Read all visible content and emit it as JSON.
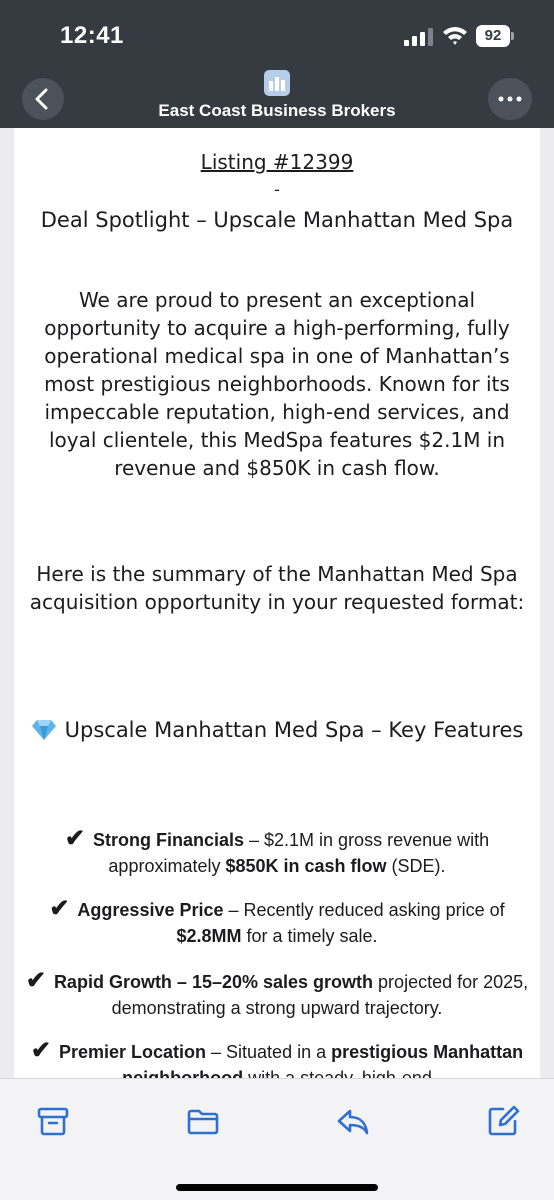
{
  "status_bar": {
    "time": "12:41",
    "battery": "92"
  },
  "header": {
    "sender": "East Coast Business Brokers"
  },
  "email": {
    "listing": "Listing #12399",
    "dash": "-",
    "headline": "Deal Spotlight – Upscale Manhattan Med Spa",
    "intro": "We are proud to present an exceptional opportunity to acquire a high-performing, fully operational medical spa in one of Manhattan’s most prestigious neighborhoods. Known for its impeccable reputation, high-end services, and loyal clientele, this MedSpa features $2.1M in revenue and $850K in cash flow.",
    "summary": "Here is the summary of the Manhattan Med Spa acquisition opportunity in your requested format:",
    "features_title": "Upscale Manhattan Med Spa – Key Features",
    "check": "✔",
    "features": [
      {
        "bold1": "Strong Financials",
        "text1": " – $2.1M in gross revenue with approximately ",
        "bold2": "$850K in cash flow",
        "text2": " (SDE)."
      },
      {
        "bold1": "Aggressive Price",
        "text1": " – Recently reduced asking price of ",
        "bold2": "$2.8MM",
        "text2": " for a timely sale."
      },
      {
        "bold1": "Rapid Growth – 15–20% sales growth",
        "text1": " projected for 2025, demonstrating a strong upward trajectory.",
        "bold2": "",
        "text2": ""
      },
      {
        "bold1": "Premier Location",
        "text1": " – Situated in a ",
        "bold2": "prestigious Manhattan neighborhood",
        "text2": " with a steady, high-end"
      }
    ]
  },
  "icons": {
    "back": "chevron-left-icon",
    "more": "ellipsis-icon",
    "logo": "building-logo-icon",
    "archive": "archive-icon",
    "folder": "folder-icon",
    "reply": "reply-icon",
    "compose": "compose-icon"
  },
  "colors": {
    "header_bg": "#353b41",
    "accent": "#2f6fd0",
    "toolbar_bg": "#f3f3f5"
  }
}
